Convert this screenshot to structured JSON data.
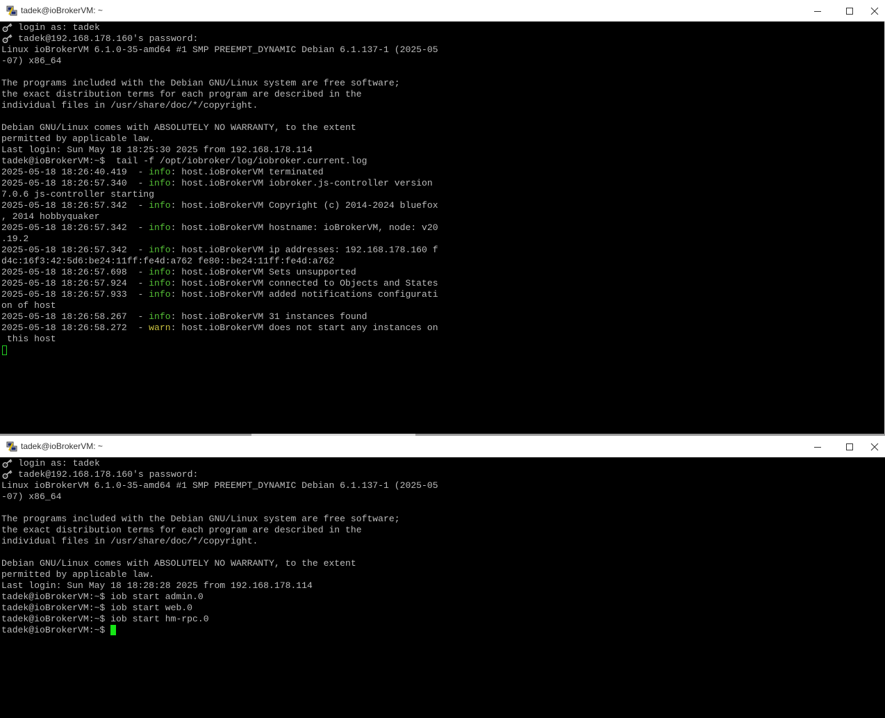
{
  "window1": {
    "title": "tadek@ioBrokerVM: ~",
    "login_line": "login as: tadek",
    "password_line": "tadek@192.168.178.160's password:",
    "lines": [
      "Linux ioBrokerVM 6.1.0-35-amd64 #1 SMP PREEMPT_DYNAMIC Debian 6.1.137-1 (2025-05",
      "-07) x86_64",
      "",
      "The programs included with the Debian GNU/Linux system are free software;",
      "the exact distribution terms for each program are described in the",
      "individual files in /usr/share/doc/*/copyright.",
      "",
      "Debian GNU/Linux comes with ABSOLUTELY NO WARRANTY, to the extent",
      "permitted by applicable law.",
      "Last login: Sun May 18 18:25:30 2025 from 192.168.178.114",
      "tadek@ioBrokerVM:~$  tail -f /opt/iobroker/log/iobroker.current.log"
    ],
    "log": [
      {
        "ts": "2025-05-18 18:26:40.419  - ",
        "level": "info",
        "msg": ": host.ioBrokerVM terminated"
      },
      {
        "ts": "2025-05-18 18:26:57.340  - ",
        "level": "info",
        "msg": ": host.ioBrokerVM iobroker.js-controller version"
      },
      {
        "cont": "7.0.6 js-controller starting"
      },
      {
        "ts": "2025-05-18 18:26:57.342  - ",
        "level": "info",
        "msg": ": host.ioBrokerVM Copyright (c) 2014-2024 bluefox"
      },
      {
        "cont": ", 2014 hobbyquaker"
      },
      {
        "ts": "2025-05-18 18:26:57.342  - ",
        "level": "info",
        "msg": ": host.ioBrokerVM hostname: ioBrokerVM, node: v20"
      },
      {
        "cont": ".19.2"
      },
      {
        "ts": "2025-05-18 18:26:57.342  - ",
        "level": "info",
        "msg": ": host.ioBrokerVM ip addresses: 192.168.178.160 f"
      },
      {
        "cont": "d4c:16f3:42:5d6:be24:11ff:fe4d:a762 fe80::be24:11ff:fe4d:a762"
      },
      {
        "ts": "2025-05-18 18:26:57.698  - ",
        "level": "info",
        "msg": ": host.ioBrokerVM Sets unsupported"
      },
      {
        "ts": "2025-05-18 18:26:57.924  - ",
        "level": "info",
        "msg": ": host.ioBrokerVM connected to Objects and States"
      },
      {
        "ts": "2025-05-18 18:26:57.933  - ",
        "level": "info",
        "msg": ": host.ioBrokerVM added notifications configurati"
      },
      {
        "cont": "on of host"
      },
      {
        "ts": "2025-05-18 18:26:58.267  - ",
        "level": "info",
        "msg": ": host.ioBrokerVM 31 instances found"
      },
      {
        "ts": "2025-05-18 18:26:58.272  - ",
        "level": "warn",
        "msg": ": host.ioBrokerVM does not start any instances on"
      },
      {
        "cont": " this host"
      }
    ]
  },
  "window2": {
    "title": "tadek@ioBrokerVM: ~",
    "login_line": "login as: tadek",
    "password_line": "tadek@192.168.178.160's password:",
    "lines": [
      "Linux ioBrokerVM 6.1.0-35-amd64 #1 SMP PREEMPT_DYNAMIC Debian 6.1.137-1 (2025-05",
      "-07) x86_64",
      "",
      "The programs included with the Debian GNU/Linux system are free software;",
      "the exact distribution terms for each program are described in the",
      "individual files in /usr/share/doc/*/copyright.",
      "",
      "Debian GNU/Linux comes with ABSOLUTELY NO WARRANTY, to the extent",
      "permitted by applicable law.",
      "Last login: Sun May 18 18:28:28 2025 from 192.168.178.114",
      "tadek@ioBrokerVM:~$ iob start admin.0",
      "tadek@ioBrokerVM:~$ iob start web.0",
      "tadek@ioBrokerVM:~$ iob start hm-rpc.0"
    ],
    "prompt": "tadek@ioBrokerVM:~$ "
  },
  "colors": {
    "info": "#55c036",
    "warn": "#c8c040",
    "text": "#bbbbbb",
    "cursor": "#16e616"
  },
  "icons": {
    "app": "putty-icon",
    "key": "key-icon",
    "minimize": "minimize-icon",
    "maximize": "maximize-icon",
    "close": "close-icon"
  }
}
